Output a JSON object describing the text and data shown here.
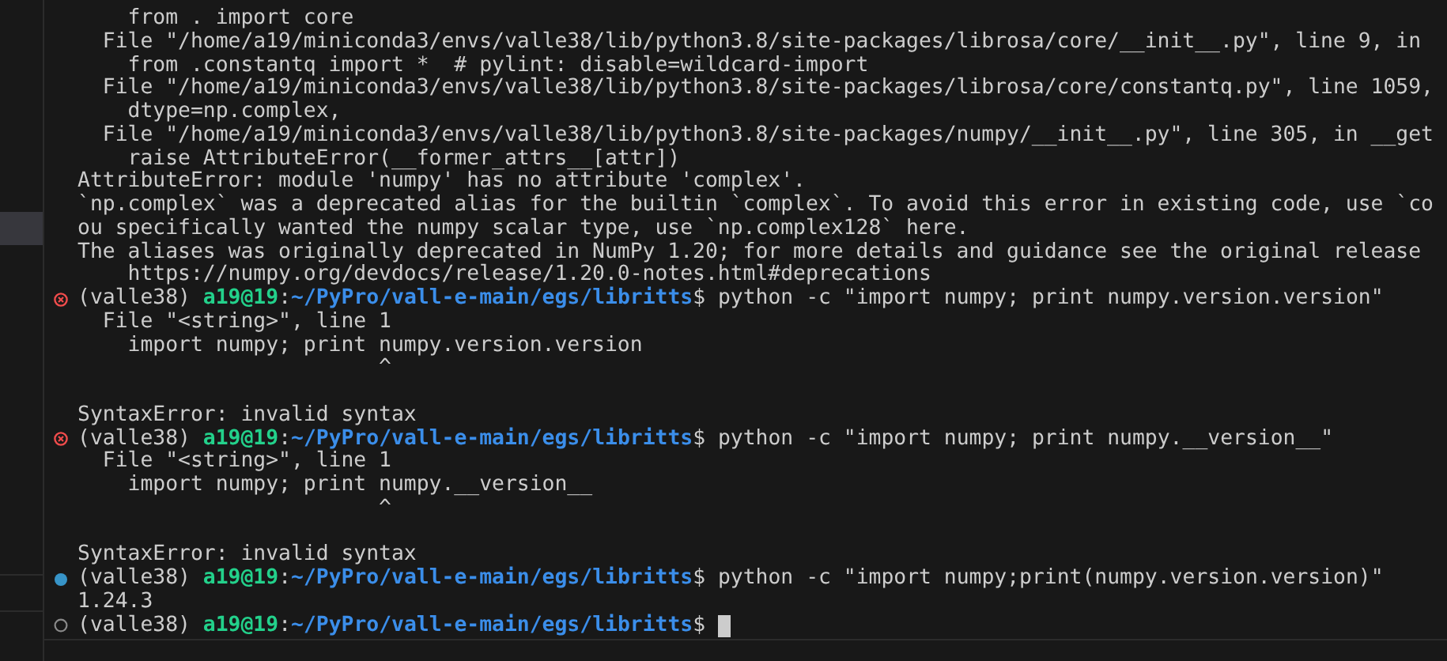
{
  "terminal": {
    "lines": [
      {
        "kind": "text",
        "text": "    from . import core"
      },
      {
        "kind": "text",
        "text": "  File \"/home/a19/miniconda3/envs/valle38/lib/python3.8/site-packages/librosa/core/__init__.py\", line 9, in"
      },
      {
        "kind": "text",
        "text": "    from .constantq import *  # pylint: disable=wildcard-import"
      },
      {
        "kind": "text",
        "text": "  File \"/home/a19/miniconda3/envs/valle38/lib/python3.8/site-packages/librosa/core/constantq.py\", line 1059,"
      },
      {
        "kind": "text",
        "text": "    dtype=np.complex,"
      },
      {
        "kind": "text",
        "text": "  File \"/home/a19/miniconda3/envs/valle38/lib/python3.8/site-packages/numpy/__init__.py\", line 305, in __get"
      },
      {
        "kind": "text",
        "text": "    raise AttributeError(__former_attrs__[attr])"
      },
      {
        "kind": "text",
        "text": "AttributeError: module 'numpy' has no attribute 'complex'."
      },
      {
        "kind": "text",
        "text": "`np.complex` was a deprecated alias for the builtin `complex`. To avoid this error in existing code, use `co"
      },
      {
        "kind": "text",
        "text": "ou specifically wanted the numpy scalar type, use `np.complex128` here."
      },
      {
        "kind": "text",
        "text": "The aliases was originally deprecated in NumPy 1.20; for more details and guidance see the original release"
      },
      {
        "kind": "text",
        "text": "    https://numpy.org/devdocs/release/1.20.0-notes.html#deprecations"
      },
      {
        "kind": "prompt_error",
        "env": "(valle38)",
        "user": "a19@19",
        "separator": ":",
        "path": "~/PyPro/vall-e-main/egs/libritts",
        "symbol": "$",
        "command": "python -c \"import numpy; print numpy.version.version\"",
        "cursor": false
      },
      {
        "kind": "text",
        "text": "  File \"<string>\", line 1"
      },
      {
        "kind": "text",
        "text": "    import numpy; print numpy.version.version"
      },
      {
        "kind": "text",
        "text": "                        ^"
      },
      {
        "kind": "blank"
      },
      {
        "kind": "text",
        "text": "SyntaxError: invalid syntax"
      },
      {
        "kind": "prompt_error",
        "env": "(valle38)",
        "user": "a19@19",
        "separator": ":",
        "path": "~/PyPro/vall-e-main/egs/libritts",
        "symbol": "$",
        "command": "python -c \"import numpy; print numpy.__version__\"",
        "cursor": false
      },
      {
        "kind": "text",
        "text": "  File \"<string>\", line 1"
      },
      {
        "kind": "text",
        "text": "    import numpy; print numpy.__version__"
      },
      {
        "kind": "text",
        "text": "                        ^"
      },
      {
        "kind": "blank"
      },
      {
        "kind": "text",
        "text": "SyntaxError: invalid syntax"
      },
      {
        "kind": "prompt_success",
        "env": "(valle38)",
        "user": "a19@19",
        "separator": ":",
        "path": "~/PyPro/vall-e-main/egs/libritts",
        "symbol": "$",
        "command": "python -c \"import numpy;print(numpy.version.version)\"",
        "cursor": false
      },
      {
        "kind": "text",
        "text": "1.24.3"
      },
      {
        "kind": "prompt_idle",
        "env": "(valle38)",
        "user": "a19@19",
        "separator": ":",
        "path": "~/PyPro/vall-e-main/egs/libritts",
        "symbol": "$",
        "cursor": true
      }
    ]
  }
}
